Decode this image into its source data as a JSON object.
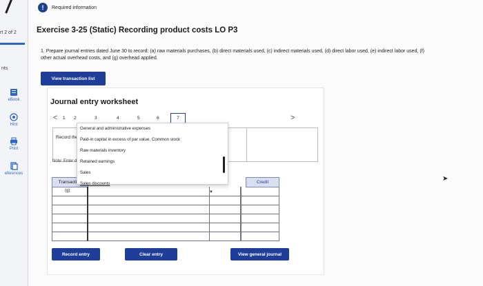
{
  "sidebar": {
    "part_label": "rt 2 of 2",
    "points_label": "nts",
    "items": [
      {
        "label": "eBook",
        "icon": "book-icon"
      },
      {
        "label": "Hint",
        "icon": "hint-icon"
      },
      {
        "label": "Print",
        "icon": "print-icon"
      },
      {
        "label": "eferences",
        "icon": "references-icon"
      }
    ]
  },
  "header": {
    "badge": "!",
    "required": "Required information"
  },
  "exercise_title": "Exercise 3-25 (Static) Recording product costs LO P3",
  "instructions": "1. Prepare journal entries dated June 30 to record: (a) raw materials purchases, (b) direct materials used, (c) indirect materials used, (d) direct labor used, (e) indirect labor used, (f) other actual overhead costs, and (g) overhead applied.",
  "view_transaction_list": "View transaction list",
  "worksheet": {
    "title": "Journal entry worksheet",
    "prev": "<",
    "next": ">",
    "pages": [
      "1",
      "2",
      "3",
      "4",
      "5",
      "6",
      "7"
    ],
    "active_page": "7",
    "record_label": "Record the",
    "note": "Note: Enter debi"
  },
  "table": {
    "headers": {
      "transaction": "Transaction",
      "credit": "Credit"
    },
    "first_transaction": "(g)"
  },
  "dropdown": {
    "options": [
      "General and administrative expenses",
      "Paid-in capital in excess of par value, Common stock",
      "Raw materials inventory",
      "Retained earnings",
      "Sales",
      "Sales discounts"
    ]
  },
  "buttons": {
    "record": "Record entry",
    "clear": "Clear entry",
    "view_general": "View general journal"
  }
}
